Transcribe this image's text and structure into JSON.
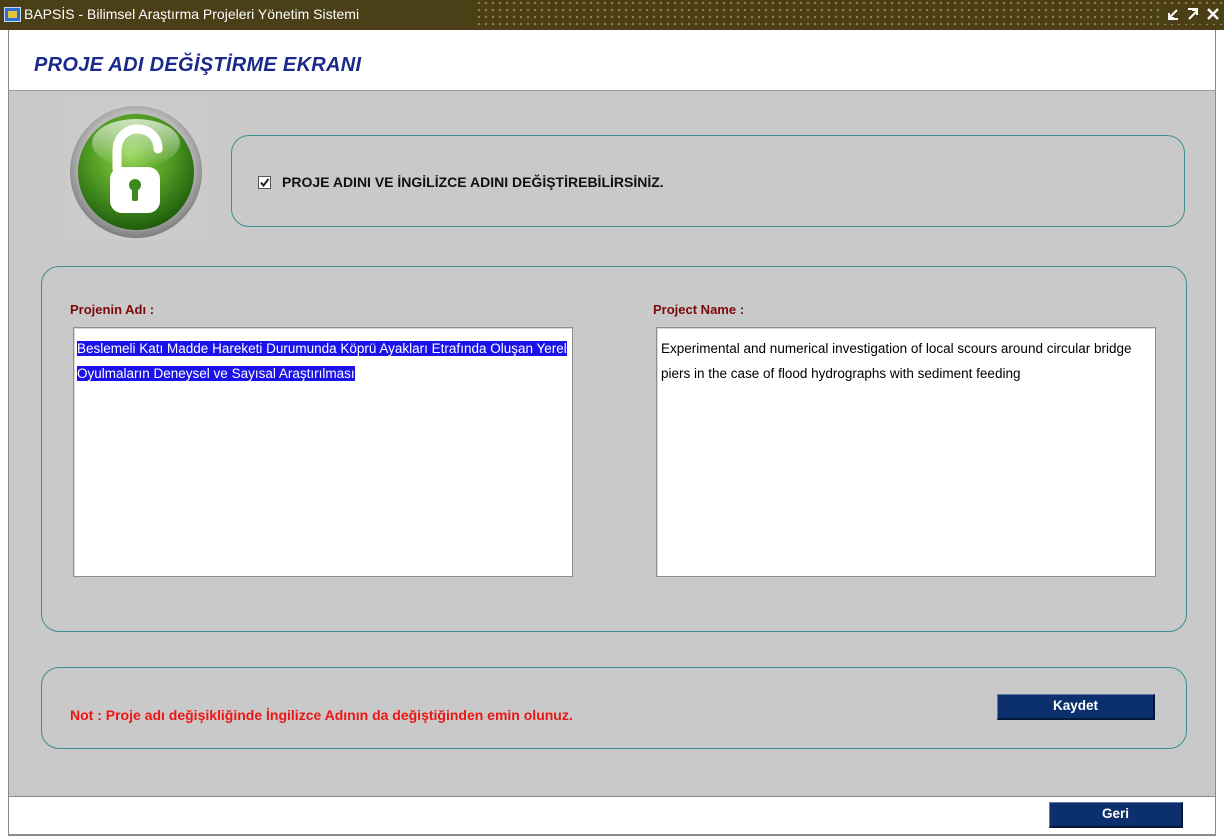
{
  "window": {
    "title": "BAPSİS - Bilimsel Araştırma Projeleri Yönetim Sistemi",
    "app_icon": "bapsis-app-icon",
    "controls": [
      "minimize-icon",
      "maximize-icon",
      "close-icon"
    ]
  },
  "page": {
    "heading": "PROJE ADI DEĞİŞTİRME EKRANI"
  },
  "info": {
    "checkbox_checked": true,
    "text": "PROJE ADINI VE İNGİLİZCE ADINI DEĞİŞTİREBİLİRSİNİZ.",
    "badge_icon": "unlocked-padlock-icon",
    "badge_color": "#4f9a23"
  },
  "names": {
    "turkish_label": "Projenin Adı :",
    "turkish_value": "Beslemeli Katı Madde Hareketi Durumunda Köprü Ayakları Etrafında Oluşan Yerel Oyulmaların Deneysel ve Sayısal Araştırılması",
    "english_label": "Project Name :",
    "english_value": "Experimental and numerical investigation of local scours around circular bridge piers in the case of flood hydrographs with sediment feeding"
  },
  "note": {
    "text": "Not : Proje adı değişikliğinde İngilizce Adının da değiştiğinden emin olunuz.",
    "save_label": "Kaydet"
  },
  "footer": {
    "back_label": "Geri"
  },
  "colors": {
    "title_bar": "#4a3f17",
    "heading": "#1a2a8a",
    "panel_border": "#3f8f8f",
    "label": "#7a0a0a",
    "note": "#ee1515",
    "button": "#0c2f6e",
    "selection": "#1a12e8"
  }
}
